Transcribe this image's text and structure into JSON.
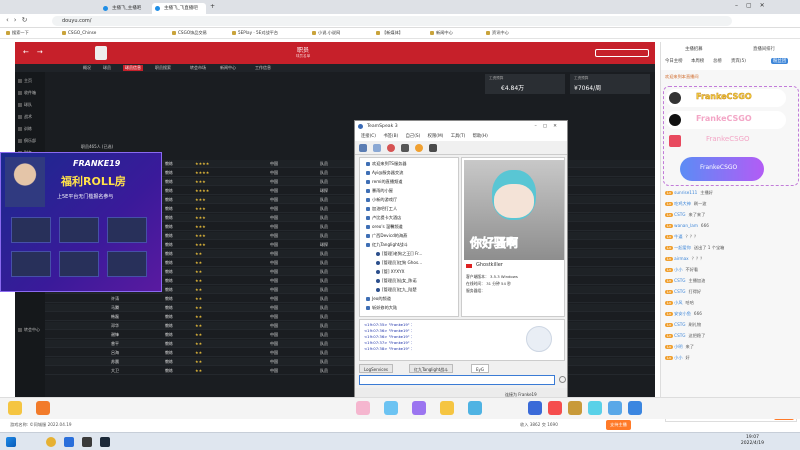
{
  "browser": {
    "tabs": [
      "主播飞_主播吧",
      "主播飞_飞直播吧"
    ],
    "url": "douyu.com/",
    "bookmarks": [
      "搜索一下",
      "CSGO_Chinse",
      "CSGO饰品交易",
      "5EPlay · 5E对战平台",
      "小说.小说网",
      "【新媒体】",
      "新闻中心",
      "资讯中心"
    ]
  },
  "game_manager": {
    "title": "职员",
    "subtitle": "球员名单",
    "nav": [
      "概况",
      "球员",
      "球员信息",
      "职员搜索",
      "转会市场",
      "新闻中心",
      "工作信息"
    ],
    "sidebar": [
      "主页",
      "收件箱",
      "球队",
      "战术",
      "训练",
      "俱乐部",
      "财务",
      "转会中心"
    ],
    "stats": [
      {
        "label": "工资预算",
        "value": "€4.84万"
      },
      {
        "label": "工资预算",
        "value": "¥7064/周"
      }
    ],
    "count_label": "职员465人 (已选)",
    "rows": [
      {
        "name": "杨立",
        "role": "教练",
        "stars": 4,
        "nation": "中国",
        "status": "队员"
      },
      {
        "name": "郑阳",
        "role": "教练",
        "stars": 4,
        "nation": "中国",
        "status": "队员"
      },
      {
        "name": "王虎",
        "role": "教练",
        "stars": 3,
        "nation": "中国",
        "status": "队员"
      },
      {
        "name": "赵强",
        "role": "教练",
        "stars": 4,
        "nation": "中国",
        "status": "球探"
      },
      {
        "name": "曹振",
        "role": "教练",
        "stars": 3,
        "nation": "中国",
        "status": "队员"
      },
      {
        "name": "阿里",
        "role": "教练",
        "stars": 3,
        "nation": "中国",
        "status": "队员"
      },
      {
        "name": "孙超",
        "role": "教练",
        "stars": 3,
        "nation": "中国",
        "status": "队员"
      },
      {
        "name": "李青",
        "role": "教练",
        "stars": 3,
        "nation": "中国",
        "status": "队员"
      },
      {
        "name": "刘凯",
        "role": "教练",
        "stars": 3,
        "nation": "中国",
        "status": "队员"
      },
      {
        "name": "何伟",
        "role": "教练",
        "stars": 3,
        "nation": "中国",
        "status": "球探"
      },
      {
        "name": "黄宇",
        "role": "教练",
        "stars": 2,
        "nation": "中国",
        "status": "队员"
      },
      {
        "name": "陈亮",
        "role": "教练",
        "stars": 2,
        "nation": "中国",
        "status": "队员"
      },
      {
        "name": "周斌",
        "role": "教练",
        "stars": 2,
        "nation": "中国",
        "status": "队员"
      },
      {
        "name": "吴明",
        "role": "教练",
        "stars": 2,
        "nation": "中国",
        "status": "队员"
      },
      {
        "name": "冯刚",
        "role": "教练",
        "stars": 2,
        "nation": "中国",
        "status": "队员"
      },
      {
        "name": "许涛",
        "role": "教练",
        "stars": 2,
        "nation": "中国",
        "status": "队员"
      },
      {
        "name": "马腾",
        "role": "教练",
        "stars": 2,
        "nation": "中国",
        "status": "队员"
      },
      {
        "name": "韩磊",
        "role": "教练",
        "stars": 2,
        "nation": "中国",
        "status": "队员"
      },
      {
        "name": "邓华",
        "role": "教练",
        "stars": 2,
        "nation": "中国",
        "status": "队员"
      },
      {
        "name": "谢锋",
        "role": "教练",
        "stars": 2,
        "nation": "中国",
        "status": "队员"
      },
      {
        "name": "曾平",
        "role": "教练",
        "stars": 2,
        "nation": "中国",
        "status": "队员"
      },
      {
        "name": "吕海",
        "role": "教练",
        "stars": 2,
        "nation": "中国",
        "status": "队员"
      },
      {
        "name": "苏晨",
        "role": "教练",
        "stars": 2,
        "nation": "中国",
        "status": "队员"
      },
      {
        "name": "大卫",
        "role": "教练",
        "stars": 2,
        "nation": "中国",
        "status": "队员"
      }
    ]
  },
  "ad": {
    "brand": "FRANKE19",
    "headline": "福利ROLL房",
    "sub": "上5E平台无门槛报名参与"
  },
  "teamspeak": {
    "title": "TeamSpeak 3",
    "menu": [
      "连接(C)",
      "书签(B)",
      "自己(S)",
      "权限(M)",
      "工具(T)",
      "帮助(H)"
    ],
    "tree": [
      {
        "text": "欢迎来到TS服务器",
        "user": false
      },
      {
        "text": "Ayi@服务器交流",
        "user": false
      },
      {
        "text": "remi的直播频道",
        "user": false
      },
      {
        "text": "暴雨的小屋",
        "user": false
      },
      {
        "text": "小新的游戏厅",
        "user": false
      },
      {
        "text": "加油吧打工人",
        "user": false
      },
      {
        "text": "卢比提卡大酒店",
        "user": false
      },
      {
        "text": "oreo's 温馨频道",
        "user": false
      },
      {
        "text": "广西Devicd的海燕",
        "user": false
      },
      {
        "text": "红九Tanglight战斗",
        "user": false
      },
      {
        "text": "[管理]老狗之王[]  Fr...",
        "user": true
      },
      {
        "text": "[管理员]红狗  Ghos...",
        "user": true
      },
      {
        "text": "[管] XYXYX",
        "user": true
      },
      {
        "text": "[管理员]仙女_陈诺",
        "user": true
      },
      {
        "text": "[管理员]红九_陆楚",
        "user": true
      },
      {
        "text": "Jeo的频道",
        "user": false
      },
      {
        "text": "斩妖修的大陆",
        "user": false
      }
    ],
    "avatar_caption": "你好骚啊",
    "info": {
      "name": "Ghostkiller",
      "lines": [
        "客户端版本：  3.5.3 Windows",
        "在线时间：  31 分钟 54 秒",
        "服务器组："
      ]
    },
    "log": [
      "<19:07:35> \"Franke19\" ：",
      "<19:07:36> \"Franke19\" ：",
      "<19:07:36> \"Franke19\" ：",
      "<19:07:37> \"Franke19\" ：",
      "<19:07:38> \"Franke19\" ："
    ],
    "tabs": [
      "LogServices",
      "红九Tanglight战斗",
      "EyG"
    ],
    "status": "连接为 Franke19"
  },
  "chat": {
    "tabs": [
      "主播招募",
      "直播间排行",
      "今日主榜",
      "本周贡献",
      "贵宾榜"
    ],
    "tab2": [
      "今日主榜",
      "本周榜",
      "总榜",
      "贵宾(5)",
      "粉丝团"
    ],
    "notice": "欢迎来到本直播间",
    "banners": [
      "FrankeCSGO",
      "FrankeCSGO",
      "FrankeCSGO",
      "FrankeCSGO"
    ],
    "messages": [
      {
        "user": "sunrise111",
        "text": "主播好"
      },
      {
        "user": "吃鸡大神",
        "text": "刷一波"
      },
      {
        "user": "CSTG",
        "text": "来了来了"
      },
      {
        "user": "wanan_lam",
        "text": "666"
      },
      {
        "user": "牛逼",
        "text": "？？？"
      },
      {
        "user": "一起爱你",
        "text": "送出了 1 个宝箱"
      },
      {
        "user": "airmax",
        "text": "？？？"
      },
      {
        "user": "小小",
        "text": "不好看"
      },
      {
        "user": "CSTG",
        "text": "主播加油"
      },
      {
        "user": "CSTG",
        "text": "打得好"
      },
      {
        "user": "小风",
        "text": "哈哈"
      },
      {
        "user": "安安小鱼",
        "text": "666"
      },
      {
        "user": "CSTG",
        "text": "刷礼物"
      },
      {
        "user": "CSTG",
        "text": "这把稳了"
      },
      {
        "user": "小明",
        "text": "来了"
      },
      {
        "user": "小小",
        "text": "好"
      }
    ],
    "input_placeholder": "发送弹幕",
    "send": "发送"
  },
  "footer": {
    "game_info": "游戏名称: ©同城服 2022.04.19",
    "stats": "收入 3862   交 1690",
    "support": "支持主播"
  },
  "taskbar": {
    "time": "19:07",
    "date": "2022/4/19"
  }
}
